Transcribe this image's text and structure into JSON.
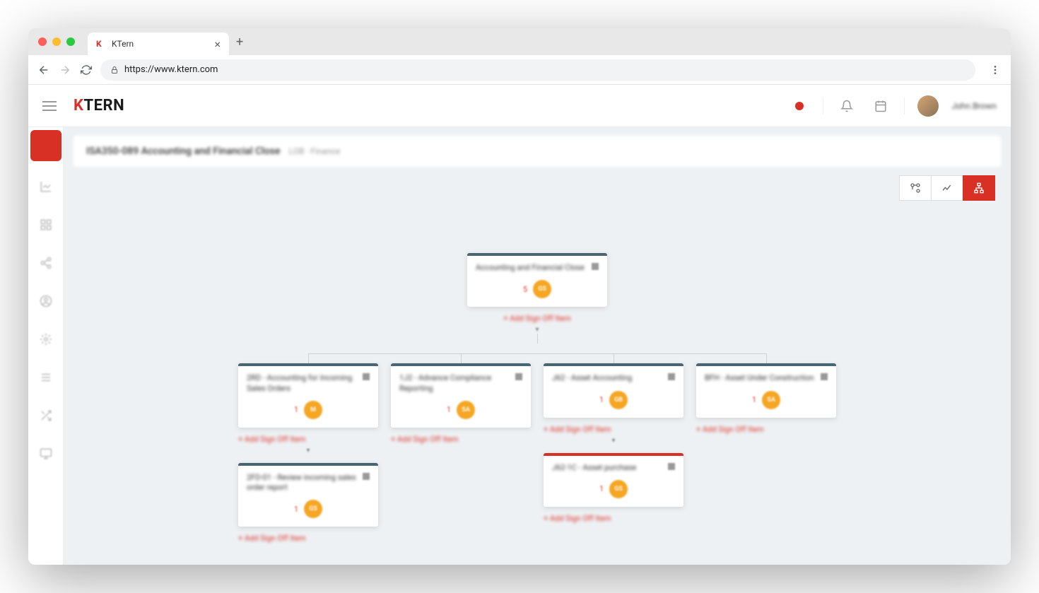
{
  "browser": {
    "tab_title": "KTern",
    "url": "https://www.ktern.com"
  },
  "header": {
    "logo_text": "KTERN",
    "username": "John.Brown"
  },
  "breadcrumb": {
    "title": "ISA350-089 Accounting and Financial Close",
    "meta": "LOB · Finance"
  },
  "toolbar": {
    "btn1": "graph-view",
    "btn2": "chart-view",
    "btn3": "tree-view"
  },
  "tree": {
    "root": {
      "title": "Accounting and Financial Close",
      "count": "5",
      "badge": "GS",
      "add_label": "+ Add Sign Off Item"
    },
    "children": [
      {
        "title": "2RD - Accounting for Incoming Sales Orders",
        "count": "1",
        "badge": "M",
        "add_label": "+ Add Sign Off Item"
      },
      {
        "title": "1J2 - Advance Compliance Reporting",
        "count": "1",
        "badge": "SA",
        "add_label": "+ Add Sign Off Item"
      },
      {
        "title": "J62 - Asset Accounting",
        "count": "1",
        "badge": "GB",
        "add_label": "+ Add Sign Off Item"
      },
      {
        "title": "BFH - Asset Under Construction",
        "count": "1",
        "badge": "SA",
        "add_label": "+ Add Sign Off Item"
      }
    ],
    "grandchildren": [
      {
        "parent": 0,
        "title": "2FD-01 - Review incoming sales order report",
        "count": "1",
        "badge": "GS",
        "add_label": "+ Add Sign Off Item",
        "bar": "teal"
      },
      {
        "parent": 2,
        "title": "J62-1C - Asset purchase",
        "count": "1",
        "badge": "GS",
        "add_label": "+ Add Sign Off Item",
        "bar": "red"
      }
    ]
  }
}
